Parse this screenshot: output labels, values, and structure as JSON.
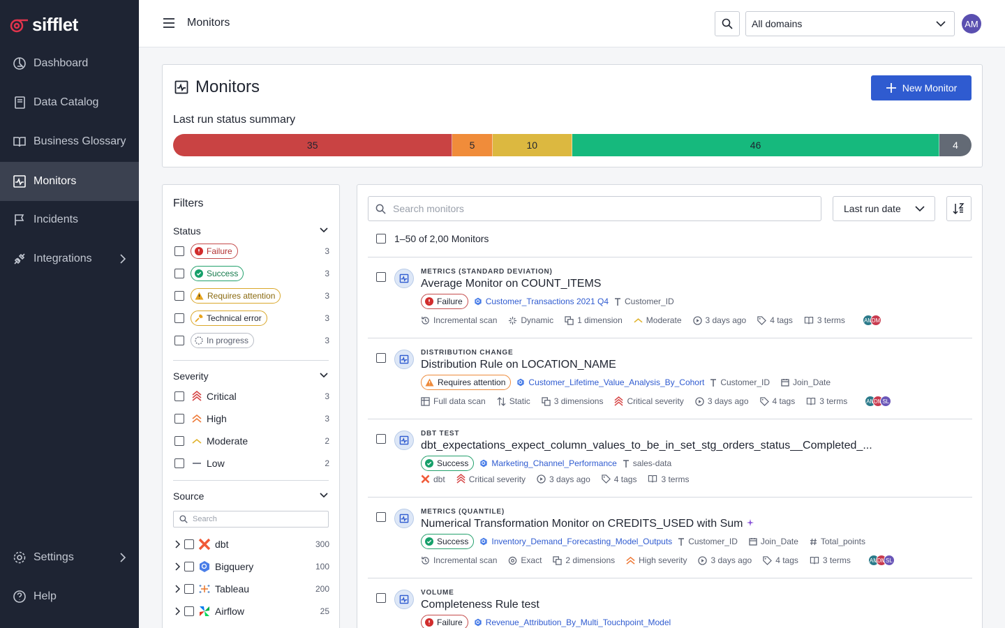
{
  "brand": {
    "name": "sifflet",
    "accent": "#e0344c"
  },
  "sidebar": {
    "items": [
      {
        "label": "Dashboard",
        "icon": "dashboard-icon",
        "active": false
      },
      {
        "label": "Data Catalog",
        "icon": "book-icon",
        "active": false
      },
      {
        "label": "Business Glossary",
        "icon": "open-book-icon",
        "active": false
      },
      {
        "label": "Monitors",
        "icon": "monitor-pulse-icon",
        "active": true
      },
      {
        "label": "Incidents",
        "icon": "flag-icon",
        "active": false
      },
      {
        "label": "Integrations",
        "icon": "plug-icon",
        "active": false
      }
    ],
    "bottom": [
      {
        "label": "Settings",
        "icon": "gear-icon"
      },
      {
        "label": "Help",
        "icon": "help-icon"
      }
    ]
  },
  "topbar": {
    "title": "Monitors",
    "domain": "All domains",
    "user_initials": "AM"
  },
  "summary": {
    "title": "Monitors",
    "new_button": "New Monitor",
    "status_label": "Last run status summary",
    "segments": [
      {
        "status": "Failure",
        "count": 35,
        "color": "#c94343"
      },
      {
        "status": "Technical error",
        "count": 5,
        "color": "#f08c3a"
      },
      {
        "status": "Requires attention",
        "count": 10,
        "color": "#dcb840"
      },
      {
        "status": "Success",
        "count": 46,
        "color": "#16b97d"
      },
      {
        "status": "In progress",
        "count": 4,
        "color": "#636a75"
      }
    ]
  },
  "filters": {
    "title": "Filters",
    "status": {
      "title": "Status",
      "items": [
        {
          "label": "Failure",
          "count": "3"
        },
        {
          "label": "Success",
          "count": "3"
        },
        {
          "label": "Requires attention",
          "count": "3"
        },
        {
          "label": "Technical error",
          "count": "3"
        },
        {
          "label": "In progress",
          "count": "3"
        }
      ]
    },
    "severity": {
      "title": "Severity",
      "items": [
        {
          "label": "Critical",
          "count": "3"
        },
        {
          "label": "High",
          "count": "3"
        },
        {
          "label": "Moderate",
          "count": "2"
        },
        {
          "label": "Low",
          "count": "2"
        }
      ]
    },
    "source": {
      "title": "Source",
      "search_placeholder": "Search",
      "items": [
        {
          "label": "dbt",
          "count": "300"
        },
        {
          "label": "Bigquery",
          "count": "100"
        },
        {
          "label": "Tableau",
          "count": "200"
        },
        {
          "label": "Airflow",
          "count": "25"
        }
      ]
    }
  },
  "list": {
    "search_placeholder": "Search monitors",
    "sort_label": "Last run date",
    "count_text": "1–50 of 2,00 Monitors",
    "monitors": [
      {
        "type": "Metrics (standard deviation)",
        "title": "Average Monitor on COUNT_ITEMS",
        "status": "Failure",
        "asset": "Customer_Transactions 2021 Q4",
        "fields": [
          "Customer_ID"
        ],
        "meta": [
          "Incremental scan",
          "Dynamic",
          "1 dimension",
          "Moderate",
          "3 days ago",
          "4 tags",
          "3 terms"
        ],
        "owners": [
          "AM",
          "DM"
        ]
      },
      {
        "type": "Distribution change",
        "title": "Distribution Rule on LOCATION_NAME",
        "status": "Requires attention",
        "asset": "Customer_Lifetime_Value_Analysis_By_Cohort",
        "fields": [
          "Customer_ID",
          "Join_Date"
        ],
        "meta": [
          "Full data scan",
          "Static",
          "3 dimensions",
          "Critical severity",
          "3 days ago",
          "4 tags",
          "3 terms"
        ],
        "owners": [
          "AM",
          "DM",
          "SL"
        ]
      },
      {
        "type": "DBT test",
        "title": "dbt_expectations_expect_column_values_to_be_in_set_stg_orders_status__Completed_...",
        "status": "Success",
        "asset": "Marketing_Channel_Performance",
        "fields": [
          "sales-data"
        ],
        "meta": [
          "dbt",
          "Critical severity",
          "3 days ago",
          "4 tags",
          "3 terms"
        ],
        "owners": []
      },
      {
        "type": "Metrics (quantile)",
        "title": "Numerical Transformation Monitor on CREDITS_USED with Sum",
        "status": "Success",
        "asset": "Inventory_Demand_Forecasting_Model_Outputs",
        "fields": [
          "Customer_ID",
          "Join_Date",
          "Total_points"
        ],
        "meta": [
          "Incremental scan",
          "Exact",
          "2 dimensions",
          "High severity",
          "3 days ago",
          "4 tags",
          "3 terms"
        ],
        "owners": [
          "AM",
          "DM",
          "SL"
        ]
      },
      {
        "type": "Volume",
        "title": "Completeness Rule test",
        "status": "Failure",
        "asset": "Revenue_Attribution_By_Multi_Touchpoint_Model",
        "fields": [],
        "meta": [],
        "owners": []
      }
    ]
  }
}
